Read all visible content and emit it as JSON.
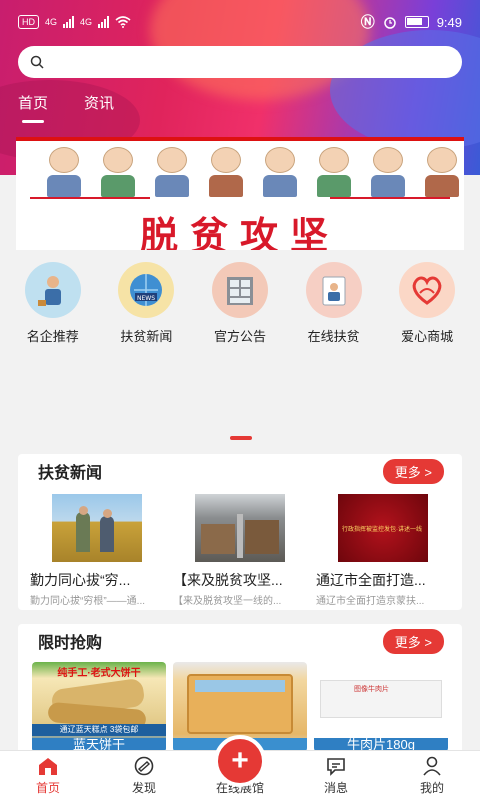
{
  "status": {
    "time": "9:49",
    "network_badge": "HD",
    "signal1": "4G",
    "signal2": "4G"
  },
  "search": {
    "placeholder": ""
  },
  "tabs": [
    {
      "label": "首页",
      "active": true
    },
    {
      "label": "资讯",
      "active": false
    }
  ],
  "banner": {
    "title": "脱贫攻坚"
  },
  "categories": [
    {
      "label": "名企推荐",
      "icon": "business-people-icon"
    },
    {
      "label": "扶贫新闻",
      "icon": "news-globe-icon"
    },
    {
      "label": "官方公告",
      "icon": "notice-board-icon"
    },
    {
      "label": "在线扶贫",
      "icon": "online-help-icon"
    },
    {
      "label": "爱心商城",
      "icon": "heart-mall-icon"
    }
  ],
  "news": {
    "title": "扶贫新闻",
    "more": "更多 >",
    "items": [
      {
        "title": "勤力同心拔“穷...",
        "sub": "勤力同心拔“穷根”——通..."
      },
      {
        "title": "【来及脱贫攻坚...",
        "sub": "【来及脱贫攻坚一线的..."
      },
      {
        "title": "通辽市全面打造...",
        "sub": "通辽市全面打造京蒙扶..."
      }
    ],
    "thumb3_caption": "行政指挥被监控发包·讲述一线"
  },
  "flash": {
    "title": "限时抢购",
    "more": "更多 >",
    "items": [
      {
        "name": "蓝天饼干",
        "pack_text": "纯手工·老式大饼干",
        "tag": "通辽蓝天糕点 3袋包邮"
      },
      {
        "name": "",
        "pack_text": ""
      },
      {
        "name": "牛肉片180g",
        "pack_text": "图像牛肉片"
      }
    ]
  },
  "bottom_nav": [
    {
      "label": "首页",
      "icon": "home-icon",
      "active": true
    },
    {
      "label": "发现",
      "icon": "discover-icon",
      "active": false
    },
    {
      "label": "在线展馆",
      "icon": "plus-icon",
      "active": false
    },
    {
      "label": "消息",
      "icon": "message-icon",
      "active": false
    },
    {
      "label": "我的",
      "icon": "profile-icon",
      "active": false
    }
  ],
  "colors": {
    "accent": "#e53935",
    "hero_start": "#c81e6e",
    "hero_end": "#3a5bd6"
  }
}
